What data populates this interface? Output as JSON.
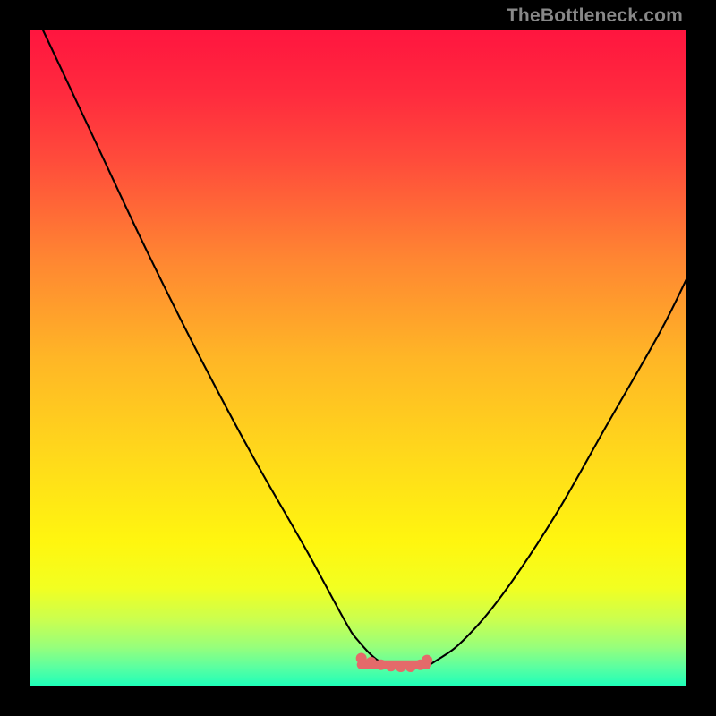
{
  "watermark": "TheBottleneck.com",
  "chart_data": {
    "type": "line",
    "title": "",
    "xlabel": "",
    "ylabel": "",
    "xlim": [
      0,
      100
    ],
    "ylim": [
      0,
      100
    ],
    "grid": false,
    "legend": false,
    "gradient_stops": [
      {
        "offset": 0.0,
        "color": "#ff153f"
      },
      {
        "offset": 0.1,
        "color": "#ff2b3e"
      },
      {
        "offset": 0.2,
        "color": "#ff4c3b"
      },
      {
        "offset": 0.35,
        "color": "#ff8632"
      },
      {
        "offset": 0.5,
        "color": "#ffb626"
      },
      {
        "offset": 0.65,
        "color": "#ffd91b"
      },
      {
        "offset": 0.78,
        "color": "#fff60f"
      },
      {
        "offset": 0.85,
        "color": "#f2ff21"
      },
      {
        "offset": 0.9,
        "color": "#c9ff51"
      },
      {
        "offset": 0.94,
        "color": "#97ff7b"
      },
      {
        "offset": 0.97,
        "color": "#5cffa0"
      },
      {
        "offset": 1.0,
        "color": "#1cffba"
      }
    ],
    "series": [
      {
        "name": "bottleneck-curve",
        "color": "#000000",
        "x": [
          2,
          10,
          18,
          26,
          34,
          42,
          48,
          50,
          53,
          56,
          58,
          60,
          62,
          66,
          72,
          80,
          88,
          96,
          100
        ],
        "values": [
          100,
          83,
          66,
          50,
          35,
          21,
          10,
          7,
          4,
          3,
          3,
          3,
          4,
          7,
          14,
          26,
          40,
          54,
          62
        ]
      }
    ],
    "flat_markers": {
      "color": "#e46a6a",
      "x": [
        50.5,
        52,
        53.5,
        55,
        56.5,
        58,
        59.5,
        60.5
      ],
      "values": [
        4.3,
        3.7,
        3.3,
        3.1,
        3.0,
        3.0,
        3.3,
        4.0
      ]
    },
    "flat_segment": {
      "color": "#e46a6a",
      "x_start": 50.5,
      "x_end": 60.5,
      "y": 3.3
    }
  }
}
